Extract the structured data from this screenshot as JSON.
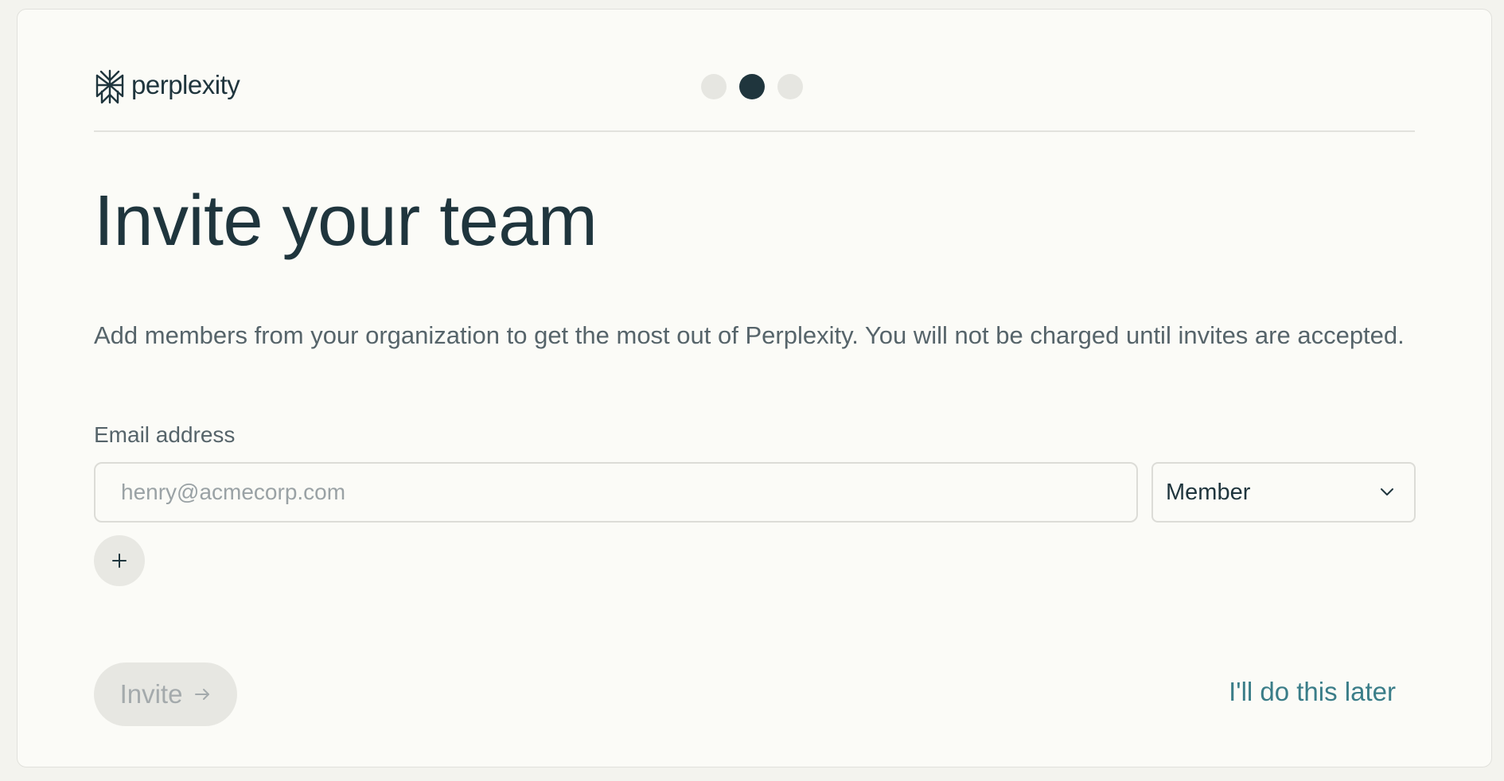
{
  "brand": {
    "name": "perplexity",
    "icon": "perplexity-logo-icon"
  },
  "stepper": {
    "total_steps": 3,
    "current_step": 2
  },
  "page": {
    "title": "Invite your team",
    "description": "Add members from your organization to get the most out of Perplexity. You will not be charged until invites are accepted."
  },
  "form": {
    "email_label": "Email address",
    "email_value": "",
    "email_placeholder": "henry@acmecorp.com",
    "role_selected": "Member",
    "add_icon": "plus-icon"
  },
  "actions": {
    "invite_label": "Invite",
    "invite_icon": "arrow-right-icon",
    "invite_disabled": true,
    "later_label": "I'll do this later"
  },
  "colors": {
    "primary_text": "#1f353d",
    "secondary_text": "#56646a",
    "link": "#3a7d88",
    "background": "#fbfbf7",
    "disabled_button": "#e7e7e2"
  }
}
